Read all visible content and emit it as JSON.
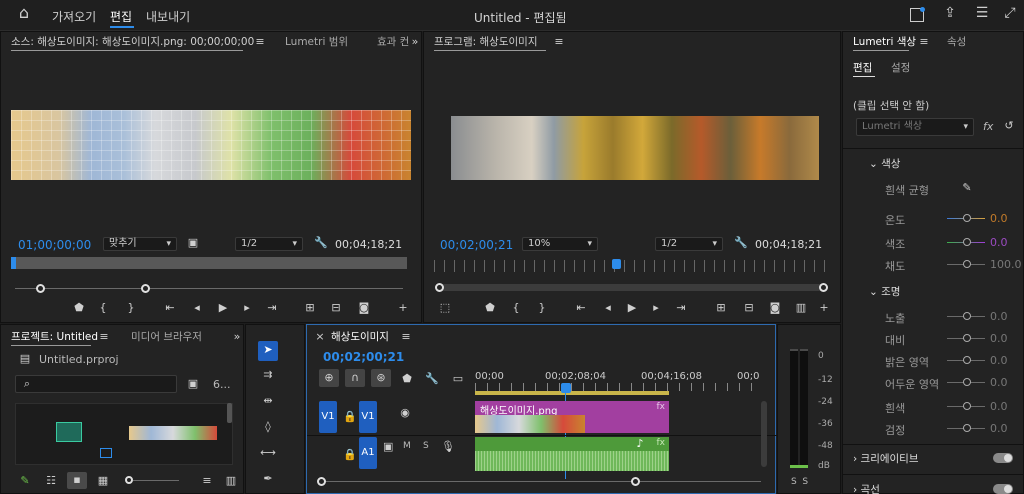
{
  "topbar": {
    "nav": [
      "가져오기",
      "편집",
      "내보내기"
    ],
    "active": "편집",
    "title": "Untitled - 편집됨"
  },
  "source": {
    "title": "소스: 해상도이미지: 해상도이미지.png: 00;00;00;00",
    "tab2": "Lumetri 범위",
    "tab3": "효과 컨",
    "timecode": "01;00;00;00",
    "fit": "맞추기",
    "res": "1/2",
    "duration": "00;04;18;21"
  },
  "program": {
    "title": "프로그램: 해상도이미지",
    "timecode": "00;02;00;21",
    "zoom": "10%",
    "res": "1/2",
    "duration": "00;04;18;21"
  },
  "lumetri": {
    "tab": "Lumetri 색상",
    "tab2": "속성",
    "sub1": "편집",
    "sub2": "설정",
    "clip_label": "(클립 선택 안 함)",
    "dropdown": "Lumetri 색상",
    "fx": "fx",
    "sec_color": "색상",
    "white_balance": "흰색 균형",
    "temp": "온도",
    "temp_val": "0.0",
    "tint": "색조",
    "tint_val": "0.0",
    "sat": "채도",
    "sat_val": "100.0",
    "sec_light": "조명",
    "exposure": "노출",
    "exposure_val": "0.0",
    "contrast": "대비",
    "contrast_val": "0.0",
    "highlights": "밝은 영역",
    "highlights_val": "0.0",
    "shadows": "어두운 영역",
    "shadows_val": "0.0",
    "whites": "흰색",
    "whites_val": "0.0",
    "blacks": "검정",
    "blacks_val": "0.0",
    "creative": "크리에이티브",
    "curves": "곡선"
  },
  "project": {
    "tab": "프로젝트: Untitled",
    "tab2": "미디어 브라우저",
    "file": "Untitled.prproj",
    "count": "6..."
  },
  "timeline": {
    "tab": "해상도이미지",
    "timecode": "00;02;00;21",
    "ruler": [
      "00;00",
      "00;02;08;04",
      "00;04;16;08",
      "00;0"
    ],
    "clip_name": "해상도이미지.png",
    "v1_src": "V1",
    "v1": "V1",
    "a1": "A1",
    "m": "M",
    "s": "S",
    "fx": "fx"
  },
  "meter": {
    "labels": [
      "0",
      "-12",
      "-24",
      "-36",
      "-48",
      "dB"
    ],
    "ss": "S  S"
  },
  "colors": {
    "accent": "#2d8ceb",
    "clip_video": "#a23fa0",
    "clip_audio": "#4e9a3a"
  }
}
